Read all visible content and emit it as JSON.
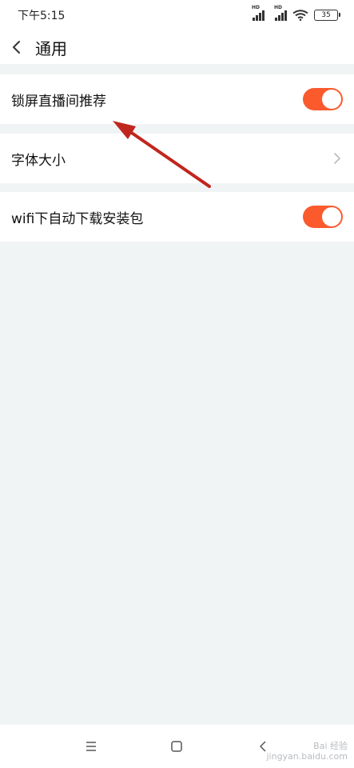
{
  "status_bar": {
    "time": "下午5:15",
    "signal_1_label": "HD",
    "signal_2_label": "HD",
    "battery_level": "35"
  },
  "header": {
    "title": "通用"
  },
  "settings": {
    "lock_screen_live": {
      "label": "锁屏直播间推荐",
      "enabled": true
    },
    "font_size": {
      "label": "字体大小"
    },
    "wifi_auto_download": {
      "label": "wifi下自动下载安装包",
      "enabled": true
    }
  },
  "colors": {
    "accent": "#fb5a2d",
    "background": "#f1f4f5",
    "annotation_arrow": "#c0261d"
  },
  "watermark": {
    "line1": "Bai 经验",
    "line2": "jingyan.baidu.com"
  }
}
